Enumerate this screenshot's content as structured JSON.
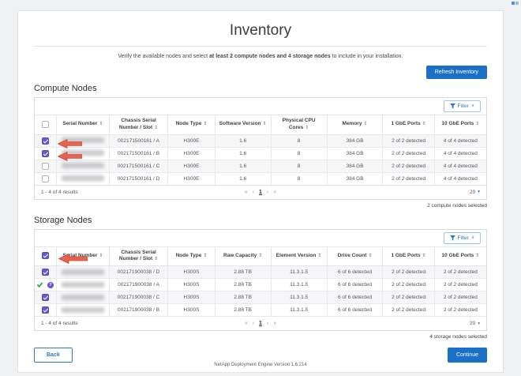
{
  "page": {
    "title": "Inventory",
    "subtitle_prefix": "Verify the available nodes and select ",
    "subtitle_bold": "at least 2 compute nodes and 4 storage nodes",
    "subtitle_suffix": " to include in your installation.",
    "footer": "NetApp Deployment Engine Version 1.6.214"
  },
  "buttons": {
    "refresh": "Refresh Inventory",
    "filter": "Filter",
    "back": "Back",
    "continue": "Continue"
  },
  "icons": {
    "sort": "⇕",
    "chevron_down": "∨",
    "caret_down": "▾",
    "question": "?",
    "first": "«",
    "prev": "‹",
    "next": "›",
    "last": "»"
  },
  "compute": {
    "heading": "Compute Nodes",
    "columns": [
      "Serial Number",
      "Chassis Serial Number / Slot",
      "Node Type",
      "Software Version",
      "Physical CPU Cores",
      "Memory",
      "1 GbE Ports",
      "10 GbE Ports"
    ],
    "rows": [
      {
        "selected": true,
        "chassis": "002171500161 / A",
        "type": "H300E",
        "sw": "1.6",
        "cpu": "8",
        "mem": "384 GB",
        "p1": "2 of 2 detected",
        "p10": "4 of 4 detected"
      },
      {
        "selected": true,
        "chassis": "002171500161 / B",
        "type": "H300E",
        "sw": "1.6",
        "cpu": "8",
        "mem": "384 GB",
        "p1": "2 of 2 detected",
        "p10": "4 of 4 detected"
      },
      {
        "selected": false,
        "chassis": "002171500161 / C",
        "type": "H300E",
        "sw": "1.6",
        "cpu": "8",
        "mem": "384 GB",
        "p1": "2 of 2 detected",
        "p10": "4 of 4 detected"
      },
      {
        "selected": false,
        "chassis": "002171500161 / D",
        "type": "H300E",
        "sw": "1.6",
        "cpu": "8",
        "mem": "384 GB",
        "p1": "2 of 2 detected",
        "p10": "4 of 4 detected"
      }
    ],
    "pagination": {
      "results": "1 - 4 of 4 results",
      "page": "1",
      "page_size": "20"
    },
    "selected_note": "2 compute nodes selected"
  },
  "storage": {
    "heading": "Storage Nodes",
    "columns": [
      "Serial Number",
      "Chassis Serial Number / Slot",
      "Node Type",
      "Raw Capacity",
      "Element Version",
      "Drive Count",
      "1 GbE Ports",
      "10 GbE Ports"
    ],
    "rows": [
      {
        "state": "checked",
        "chassis": "002171900038 / D",
        "type": "H300S",
        "cap": "2.88 TB",
        "ver": "11.3.1.5",
        "drives": "6 of 6 detected",
        "p1": "2 of 2 detected",
        "p10": "2 of 2 detected"
      },
      {
        "state": "confirmed",
        "chassis": "002171900038 / A",
        "type": "H300S",
        "cap": "2.88 TB",
        "ver": "11.3.1.5",
        "drives": "6 of 6 detected",
        "p1": "2 of 2 detected",
        "p10": "2 of 2 detected"
      },
      {
        "state": "checked",
        "chassis": "002171900038 / C",
        "type": "H300S",
        "cap": "2.88 TB",
        "ver": "11.3.1.5",
        "drives": "6 of 6 detected",
        "p1": "2 of 2 detected",
        "p10": "2 of 2 detected"
      },
      {
        "state": "checked",
        "chassis": "002171900038 / B",
        "type": "H300S",
        "cap": "2.88 TB",
        "ver": "11.3.1.5",
        "drives": "6 of 6 detected",
        "p1": "2 of 2 detected",
        "p10": "2 of 2 detected"
      }
    ],
    "pagination": {
      "results": "1 - 4 of 4 results",
      "page": "1",
      "page_size": "20"
    },
    "selected_note": "4 storage nodes selected"
  }
}
